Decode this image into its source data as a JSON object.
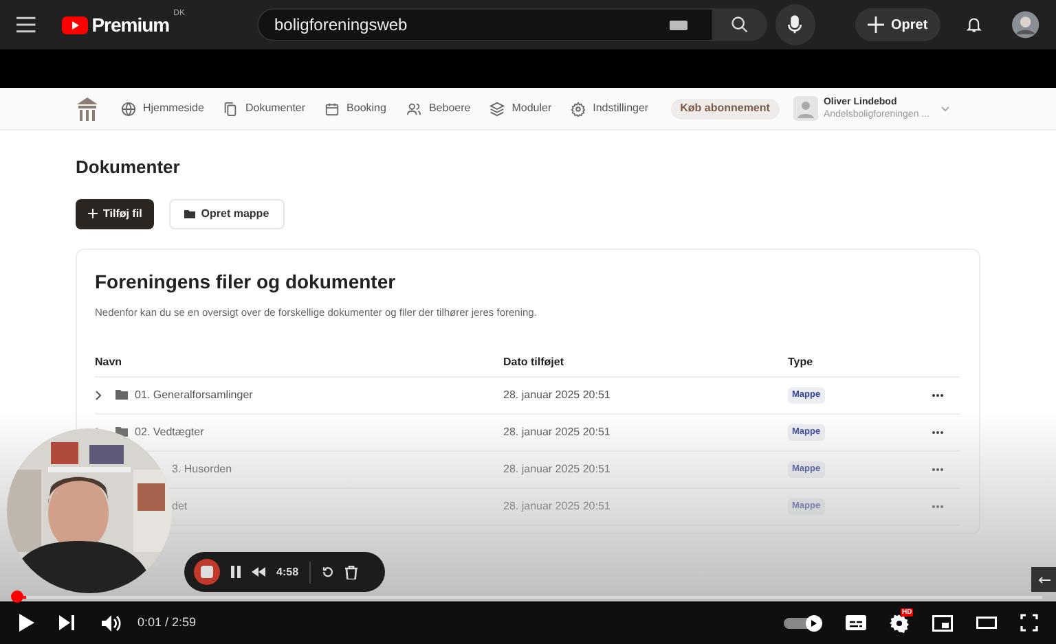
{
  "header": {
    "logo": "Premium",
    "region": "DK",
    "search": {
      "value": "boligforeningsweb"
    },
    "create_button": "Opret"
  },
  "page": {
    "nav": [
      {
        "label": "Hjemmeside"
      },
      {
        "label": "Dokumenter"
      },
      {
        "label": "Booking"
      },
      {
        "label": "Beboere"
      },
      {
        "label": "Moduler"
      },
      {
        "label": "Indstillinger"
      }
    ],
    "subscribe_button": "Køb abonnement",
    "user": {
      "name": "Oliver Lindebod",
      "org": "Andelsboligforeningen ..."
    },
    "title": "Dokumenter",
    "buttons": [
      {
        "label": "Tilføj fil",
        "kind": "primary"
      },
      {
        "label": "Opret mappe",
        "kind": "secondary"
      }
    ],
    "card": {
      "title": "Foreningens filer og dokumenter",
      "description": "Nedenfor kan du se en oversigt over de forskellige dokumenter og filer der tilhører jeres forening.",
      "columns": [
        "Navn",
        "Dato tilføjet",
        "Type"
      ],
      "rows": [
        {
          "name": "01. Generalforsamlinger",
          "date": "28. januar 2025 20:51",
          "type": "Mappe",
          "covered": false
        },
        {
          "name": "02. Vedtægter",
          "date": "28. januar 2025 20:51",
          "type": "Mappe",
          "covered": false
        },
        {
          "name": "3. Husorden",
          "date": "28. januar 2025 20:51",
          "type": "Mappe",
          "covered": true
        },
        {
          "name": "det",
          "date": "28. januar 2025 20:51",
          "type": "Mappe",
          "covered": true
        }
      ]
    }
  },
  "recorder": {
    "time": "4:58"
  },
  "player": {
    "time": "0:01 / 2:59",
    "level": 0.003,
    "quality_badge": "HD"
  }
}
